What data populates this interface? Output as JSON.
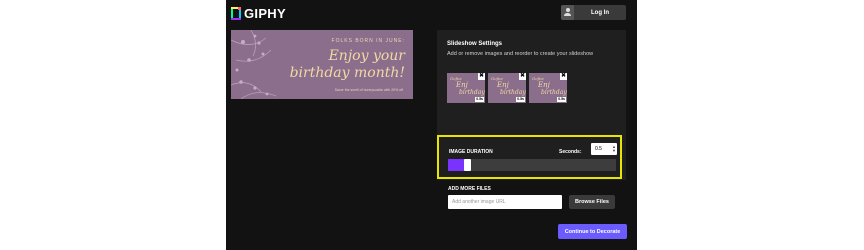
{
  "brand": {
    "name": "GIPHY",
    "colors": [
      "#00ff99",
      "#fff35c",
      "#00ccff",
      "#9933ff",
      "#ff6666"
    ]
  },
  "header": {
    "login_label": "Log In",
    "login_icon": "user-icon"
  },
  "preview": {
    "top_line": "FOLKS BORN IN JUNE:",
    "line1": "Enjoy your",
    "line2": "birthday month!",
    "small": "Savor the smell of honeysuckle with 20% off"
  },
  "settings": {
    "title": "Slideshow Settings",
    "subtitle": "Add or remove images and reorder to create your slideshow",
    "thumbnails": [
      {
        "t1": "Gofee",
        "t2": "Enj",
        "t3": "birthday",
        "duration": "0.5s"
      },
      {
        "t1": "Gofee",
        "t2": "Enj",
        "t3": "birthday",
        "duration": "0.5s"
      },
      {
        "t1": "Gofee",
        "t2": "Enj",
        "t3": "birthday",
        "duration": "0.5s"
      }
    ],
    "remove_symbol": "✖"
  },
  "duration": {
    "title": "IMAGE DURATION",
    "seconds_label": "Seconds:",
    "seconds_value": "0.5",
    "slider_fraction": 0.1,
    "accent": "#7a33ff"
  },
  "more": {
    "label": "ADD MORE FILES",
    "url_placeholder": "Add another image URL",
    "browse_label": "Browse Files"
  },
  "cta": {
    "continue_label": "Continue to Decorate",
    "color": "#6b5cff"
  }
}
